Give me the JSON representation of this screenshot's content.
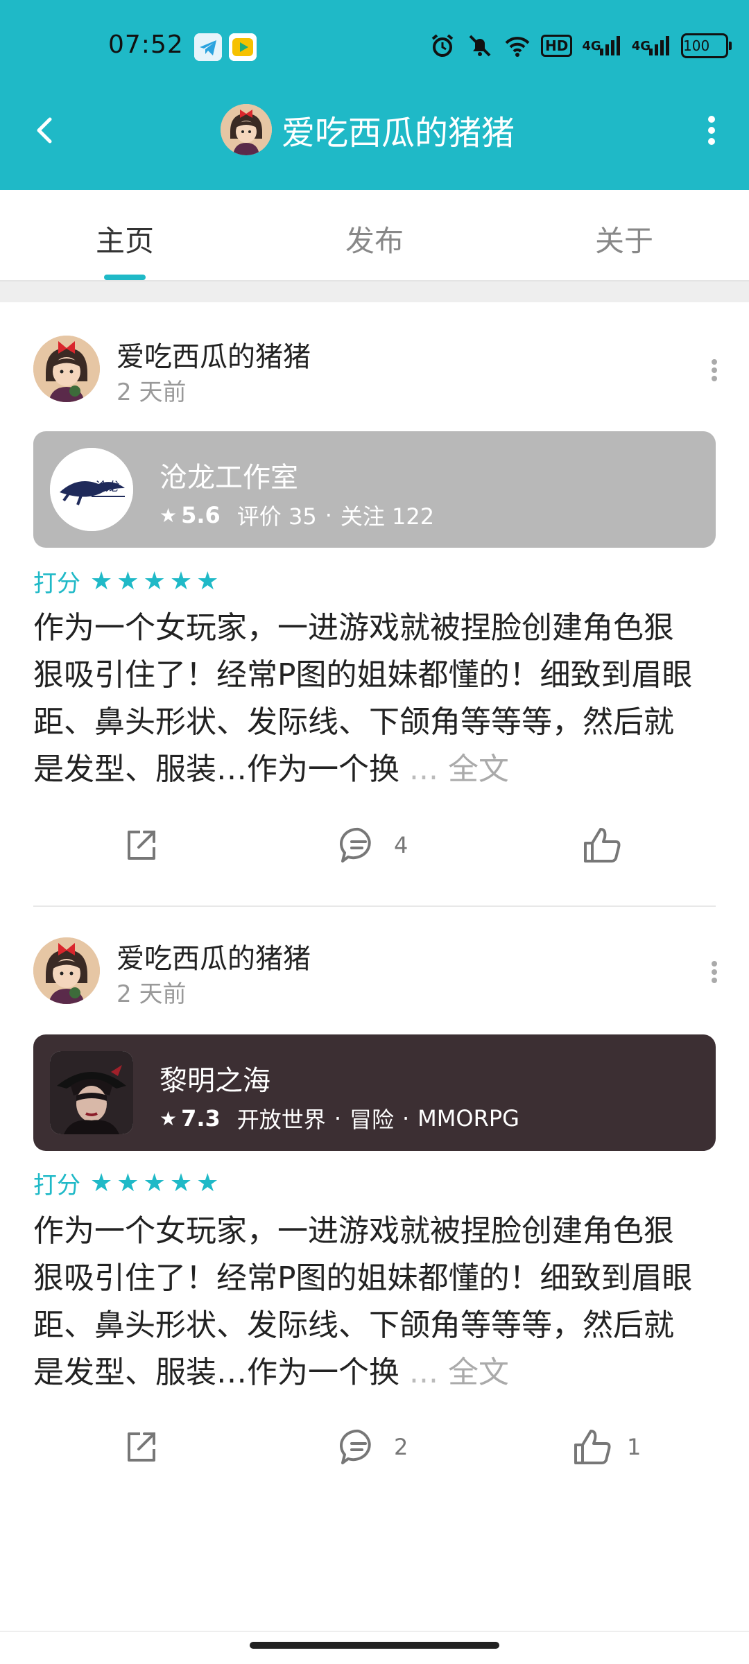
{
  "statusbar": {
    "time": "07:52",
    "hd": "HD",
    "net1": "4G",
    "net2": "4G",
    "battery": "100"
  },
  "header": {
    "title": "爱吃西瓜的猪猪",
    "back_icon": "chevron-left-icon",
    "more_icon": "more-vertical-icon"
  },
  "tabs": [
    {
      "label": "主页"
    },
    {
      "label": "发布"
    },
    {
      "label": "关于"
    }
  ],
  "posts": [
    {
      "author": "爱吃西瓜的猪猪",
      "time": "2 天前",
      "game": {
        "name": "沧龙工作室",
        "score": "5.6",
        "meta1": "评价 35",
        "meta2": "关注 122"
      },
      "rating_label": "打分",
      "stars": "★★★★★",
      "text": "作为一个女玩家，一进游戏就被捏脸创建角色狠狠吸引住了！经常P图的姐妹都懂的！细致到眉眼距、鼻头形状、发际线、下颌角等等等，然后就是发型、服装…作为一个换",
      "ellipsis": " ... ",
      "more_label": "全文",
      "comments": "4",
      "likes": ""
    },
    {
      "author": "爱吃西瓜的猪猪",
      "time": "2 天前",
      "game": {
        "name": "黎明之海",
        "score": "7.3",
        "meta1": "开放世界",
        "meta2": "冒险",
        "meta3": "MMORPG"
      },
      "rating_label": "打分",
      "stars": "★★★★★",
      "text": "作为一个女玩家，一进游戏就被捏脸创建角色狠狠吸引住了！经常P图的姐妹都懂的！细致到眉眼距、鼻头形状、发际线、下颌角等等等，然后就是发型、服装…作为一个换",
      "ellipsis": " ... ",
      "more_label": "全文",
      "comments": "2",
      "likes": "1"
    }
  ],
  "colors": {
    "accent": "#1fb9c7",
    "header_bg": "#1fb9c7",
    "card_gray": "#b8b8b8",
    "card_dark": "#3c2f33"
  }
}
